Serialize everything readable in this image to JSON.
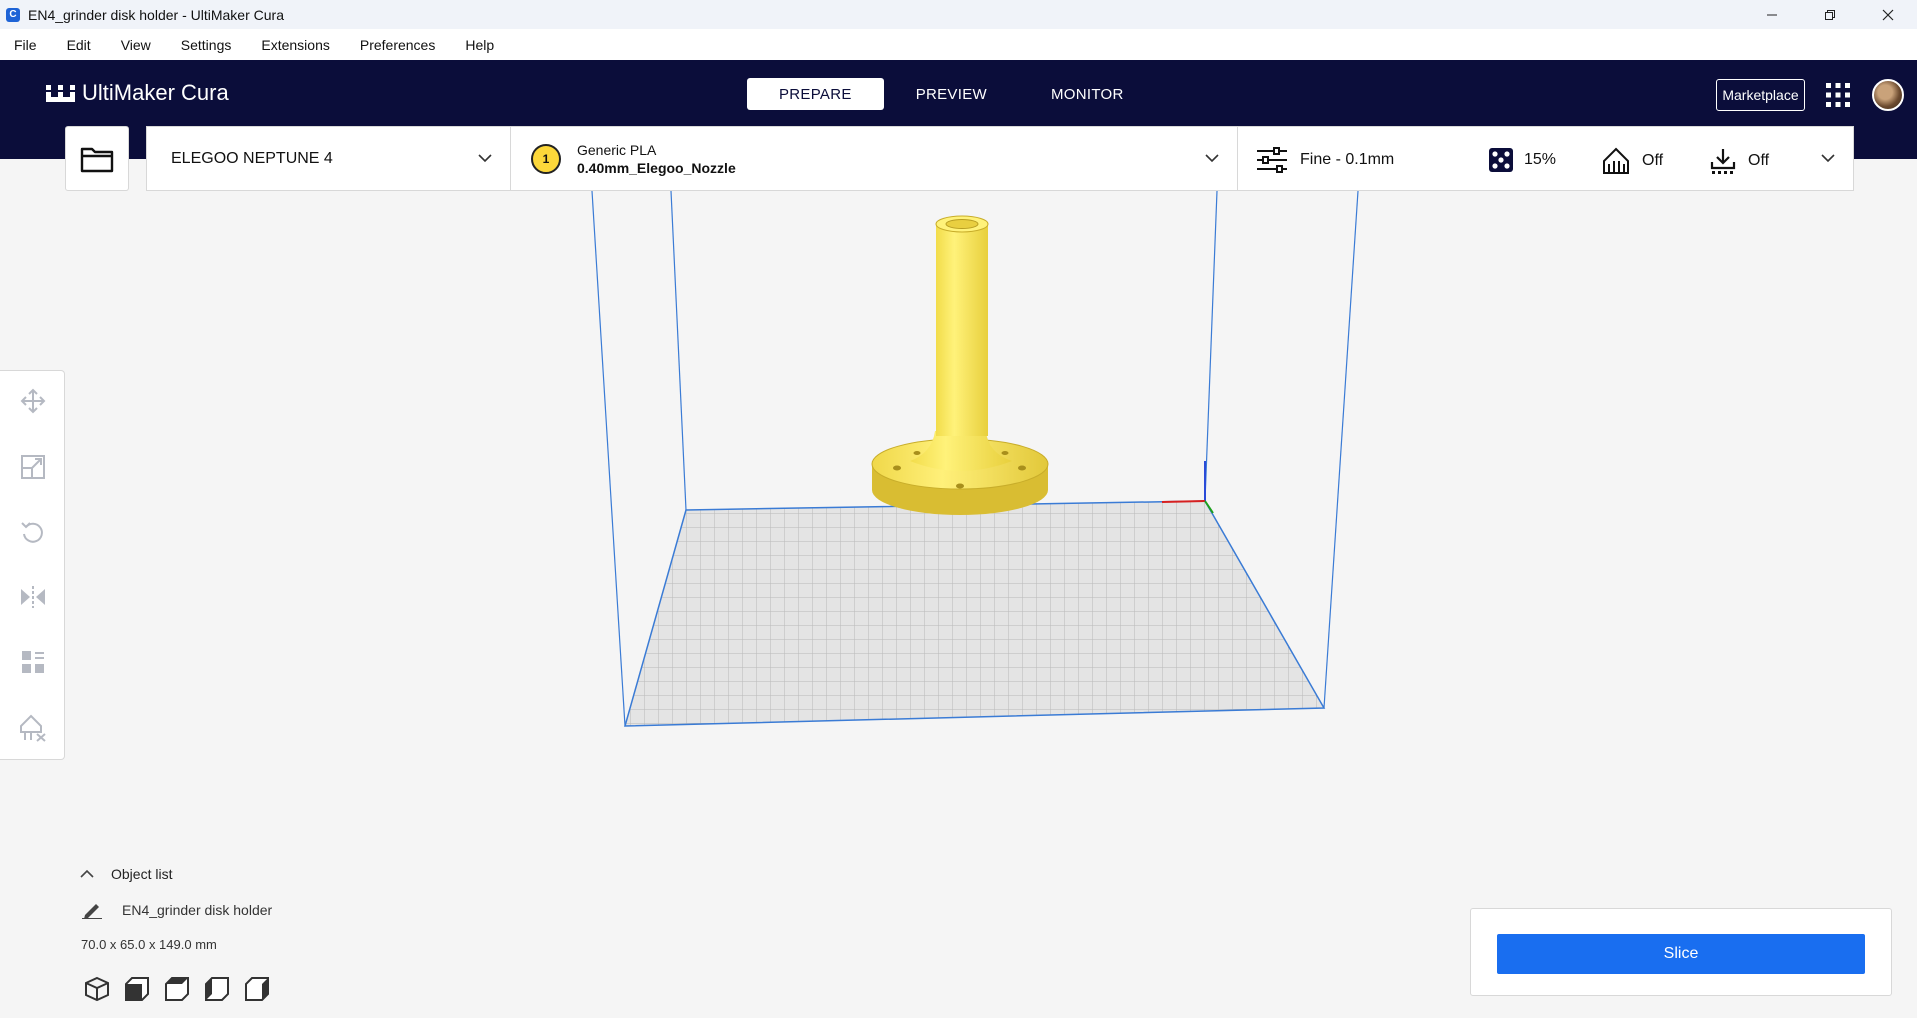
{
  "window": {
    "title": "EN4_grinder disk holder - UltiMaker Cura",
    "app_icon_letter": "C"
  },
  "menu": {
    "items": [
      "File",
      "Edit",
      "View",
      "Settings",
      "Extensions",
      "Preferences",
      "Help"
    ]
  },
  "header": {
    "logo_text": "UltiMaker Cura",
    "tabs": [
      {
        "label": "PREPARE",
        "active": true
      },
      {
        "label": "PREVIEW",
        "active": false
      },
      {
        "label": "MONITOR",
        "active": false
      }
    ],
    "marketplace_label": "Marketplace"
  },
  "printer": {
    "name": "ELEGOO NEPTUNE 4"
  },
  "material": {
    "extruder_number": "1",
    "name": "Generic PLA",
    "nozzle": "0.40mm_Elegoo_Nozzle"
  },
  "print_settings": {
    "profile": "Fine - 0.1mm",
    "infill": "15%",
    "support": "Off",
    "adhesion": "Off"
  },
  "object_list": {
    "header_label": "Object list",
    "item_name": "EN4_grinder disk holder",
    "dimensions": "70.0 x 65.0 x 149.0 mm"
  },
  "slice": {
    "button_label": "Slice"
  },
  "colors": {
    "header_bg": "#0b0d3a",
    "accent_blue": "#196ef0",
    "model_yellow": "#fff176",
    "build_volume_line": "#3a7bd5"
  },
  "icons": {
    "left_tools": [
      "move-icon",
      "scale-icon",
      "rotate-icon",
      "mirror-icon",
      "per-model-settings-icon",
      "support-blocker-icon"
    ],
    "view_buttons": [
      "3d-view-icon",
      "front-view-icon",
      "top-view-icon",
      "left-view-icon",
      "right-view-icon"
    ]
  }
}
